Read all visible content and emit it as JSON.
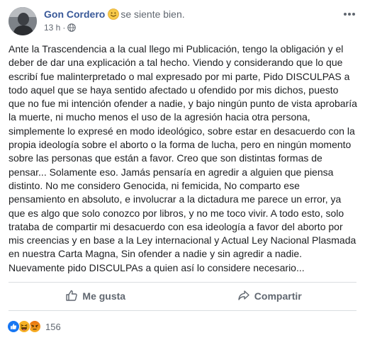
{
  "post": {
    "author": "Gon Cordero",
    "feeling_text": "se siente bien.",
    "feeling_icon": "smiling-face-icon",
    "timestamp": "13 h",
    "separator": "·",
    "privacy_icon": "globe-icon",
    "menu_icon": "more-options-icon",
    "body_lines": [
      "Ante la Trascendencia a la cual llego mi Publicación, tengo la obligación y el",
      "deber de dar una explicación a tal hecho. Viendo y considerando que lo que",
      "escribí fue malinterpretado o mal expresado por mi parte, Pido DISCULPAS a",
      "todo aquel que se haya sentido afectado u ofendido por mis dichos, puesto",
      "que no fue mi intención ofender a nadie, y bajo ningún punto de vista aprobaría",
      "la muerte, ni mucho menos el uso de la agresión hacia otra persona,",
      "simplemente lo expresé en modo ideológico, sobre estar en desacuerdo con la",
      "propia ideología sobre el aborto o la forma de lucha, pero en ningún momento",
      "sobre las personas que están a favor. Creo que son distintas formas de",
      "pensar... Solamente eso. Jamás pensaría en agredir a alguien que piensa",
      "distinto. No me considero Genocida, ni femicida, No comparto ese",
      "pensamiento en absoluto, e involucrar a la dictadura me parece un error, ya",
      "que es algo que solo conozco por libros, y no me toco vivir. A todo esto, solo",
      "trataba de compartir mi desacuerdo con esa ideología a favor del aborto por",
      "mis creencias y en base a la Ley internacional y Actual Ley Nacional Plasmada",
      "en nuestra Carta Magna, Sin ofender a nadie y sin agredir a nadie.",
      "Nuevamente pido DISCULPAs a quien así lo considere necesario..."
    ]
  },
  "actions": {
    "like_label": "Me gusta",
    "like_icon": "thumbs-up-icon",
    "share_label": "Compartir",
    "share_icon": "share-arrow-icon"
  },
  "reactions": {
    "types": [
      "like-reaction-icon",
      "haha-reaction-icon",
      "angry-reaction-icon"
    ],
    "count": "156"
  },
  "colors": {
    "author": "#385898",
    "text": "#1c1e21",
    "muted": "#606770",
    "divider": "#dadde1",
    "like_blue": "#1877f2",
    "haha_yellow": "#f7b125",
    "angry_orange": "#e9710f"
  }
}
